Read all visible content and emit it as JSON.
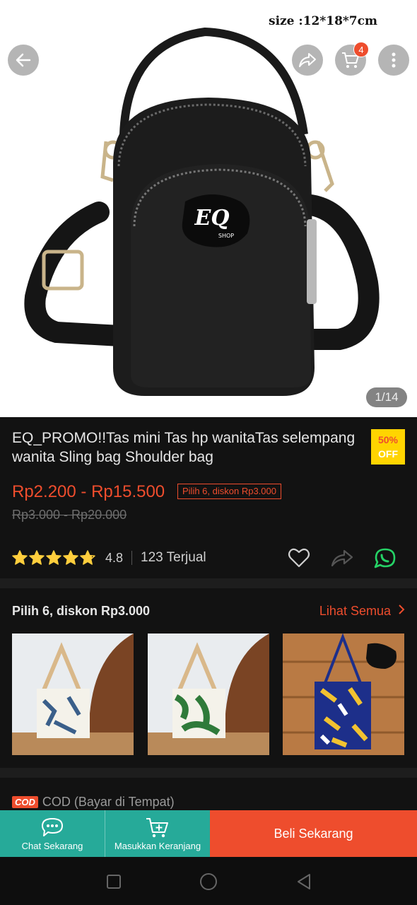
{
  "hero": {
    "size_label": "size :12*18*7cm",
    "cart_count": "4",
    "image_counter": "1/14",
    "logo_text": "EQ",
    "logo_sub": "SHOP"
  },
  "product": {
    "title": "EQ_PROMO!!Tas mini Tas hp wanitaTas selempang wanita Sling bag Shoulder bag",
    "discount_percent": "50%",
    "discount_off": "OFF",
    "price": "Rp2.200 - Rp15.500",
    "promo_badge": "Pilih 6, diskon Rp3.000",
    "original_price": "Rp3.000 - Rp20.000",
    "rating": "4.8",
    "rating_stars_value": 4.8,
    "sold": "123 Terjual"
  },
  "bundle": {
    "title": "Pilih 6, diskon Rp3.000",
    "see_all": "Lihat Semua"
  },
  "cod": {
    "logo": "COD",
    "text": "COD (Bayar di Tempat)"
  },
  "bottom_bar": {
    "chat_label": "Chat Sekarang",
    "cart_label": "Masukkan Keranjang",
    "buy_label": "Beli Sekarang"
  },
  "colors": {
    "accent": "#ee4d2d",
    "teal": "#26aa99",
    "star": "#ffce3d",
    "whatsapp": "#25d366"
  }
}
